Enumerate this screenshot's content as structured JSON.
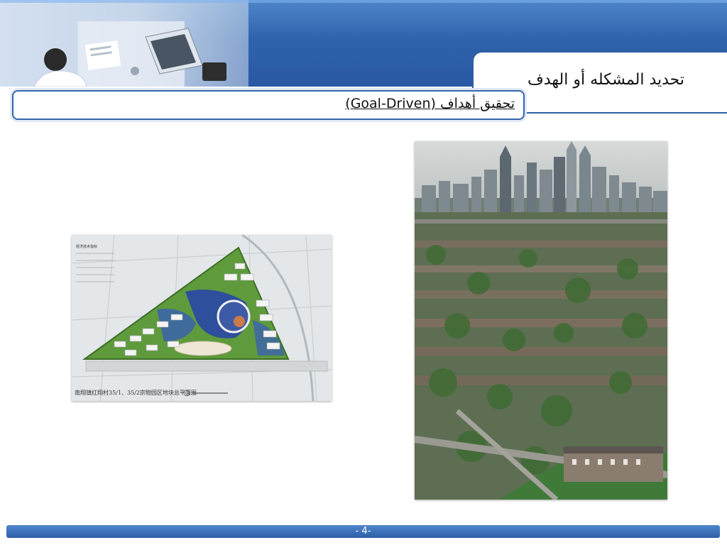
{
  "slide": {
    "title": "تحديد المشكله أو الهدف",
    "subtitle": "تحقيق أهداف (Goal-Driven)",
    "page_number": "- 4-"
  },
  "images": {
    "site_plan_caption": "南翔镇红翔村35/1、35/2宗物园区地块总平面图",
    "site_plan_table_heading": "经济技术指标"
  },
  "colors": {
    "header_blue": "#2f63ad",
    "footer_blue": "#2d5ea8",
    "frame_blue": "#3565ac"
  }
}
